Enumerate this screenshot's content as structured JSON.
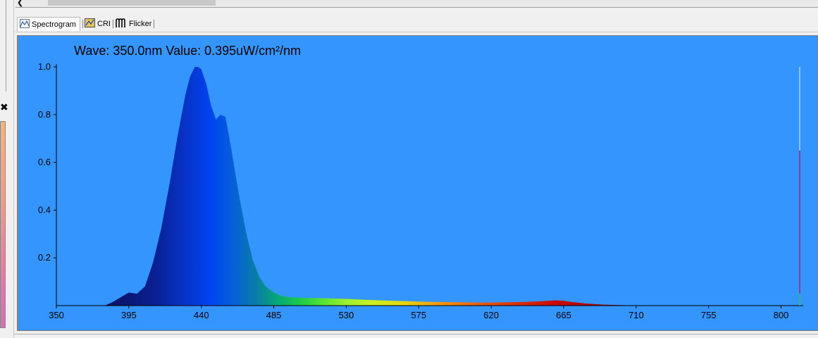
{
  "tabs": [
    {
      "label": "Spectrogram",
      "icon": "spectrogram-icon",
      "active": true
    },
    {
      "label": "CRI",
      "icon": "cri-icon",
      "active": false
    },
    {
      "label": "Flicker",
      "icon": "flicker-icon",
      "active": false
    }
  ],
  "readout": "Wave: 350.0nm  Value: 0.395uW/cm²/nm",
  "colors": {
    "plot_background": "#3495fe",
    "axis": "#000000"
  },
  "chart_data": {
    "type": "area",
    "title": "",
    "xlabel": "",
    "ylabel": "",
    "xlim": [
      350,
      805
    ],
    "ylim": [
      0,
      1.0
    ],
    "x_ticks": [
      "350",
      "395",
      "440",
      "485",
      "530",
      "575",
      "620",
      "665",
      "710",
      "755",
      "800"
    ],
    "y_ticks": [
      "0.2",
      "0.4",
      "0.6",
      "0.8",
      "1.0"
    ],
    "grid": false,
    "fill": "spectral wavelength colors",
    "cursor_wavelength": 350.0,
    "series": [
      {
        "x": [
          380,
          385,
          390,
          395,
          400,
          405,
          410,
          415,
          420,
          425,
          430,
          433,
          436,
          438,
          440,
          443,
          446,
          449,
          452,
          455,
          458,
          461,
          464,
          468,
          472,
          476,
          480,
          485,
          490,
          495,
          500,
          510,
          520,
          530,
          540,
          550,
          560,
          570,
          580,
          590,
          600,
          610,
          620,
          630,
          640,
          650,
          655,
          660,
          665,
          670,
          680,
          690,
          700,
          710,
          720,
          730,
          750,
          780,
          800,
          805
        ],
        "y": [
          0.0,
          0.015,
          0.035,
          0.055,
          0.05,
          0.08,
          0.18,
          0.32,
          0.5,
          0.7,
          0.88,
          0.96,
          1.0,
          1.0,
          0.99,
          0.93,
          0.84,
          0.78,
          0.8,
          0.79,
          0.68,
          0.56,
          0.44,
          0.3,
          0.19,
          0.12,
          0.08,
          0.055,
          0.04,
          0.035,
          0.033,
          0.032,
          0.03,
          0.028,
          0.025,
          0.022,
          0.02,
          0.018,
          0.016,
          0.015,
          0.014,
          0.013,
          0.013,
          0.014,
          0.015,
          0.018,
          0.02,
          0.022,
          0.02,
          0.015,
          0.008,
          0.004,
          0.002,
          0.001,
          0.0,
          0.0,
          0.0,
          0.0,
          0.0,
          0.0
        ]
      }
    ]
  }
}
